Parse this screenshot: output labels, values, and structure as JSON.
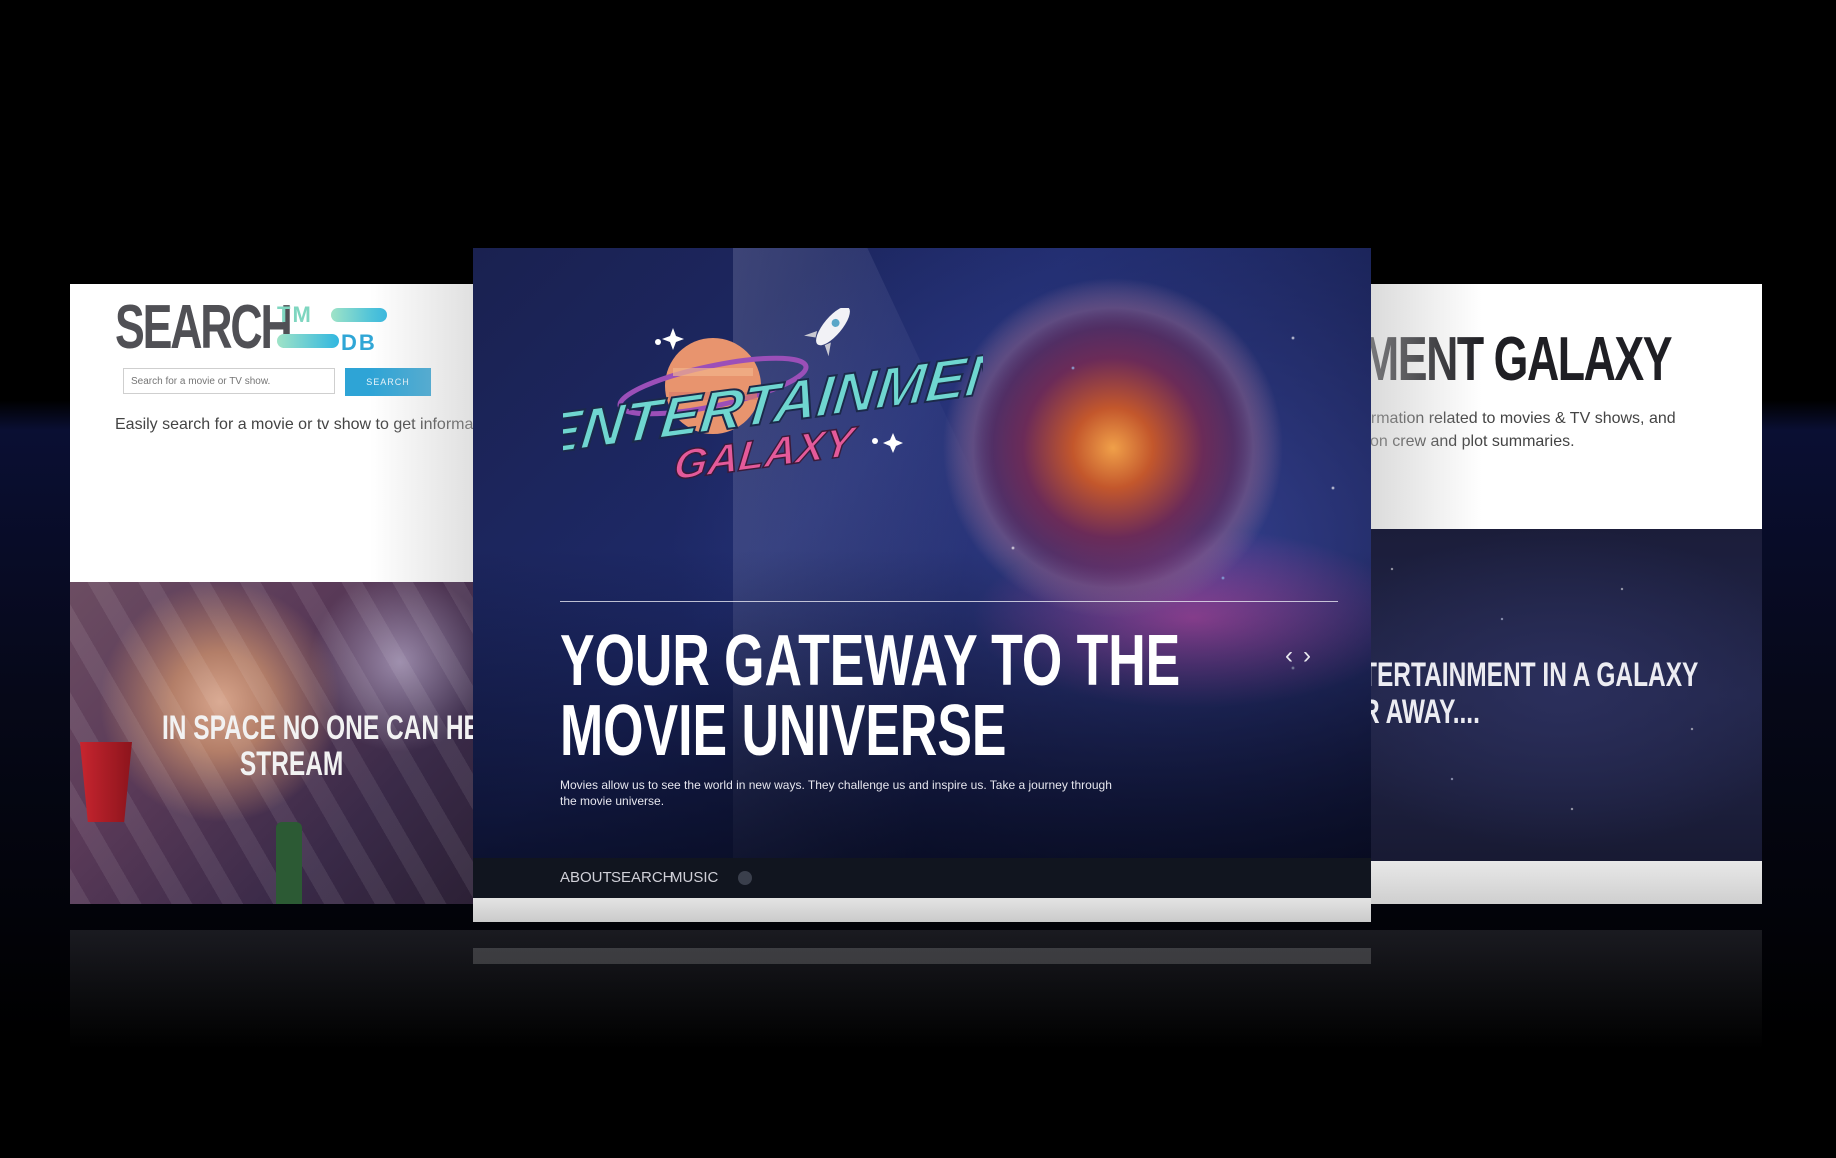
{
  "left_panel": {
    "logo_word": "SEARCH",
    "logo_tm": "TM",
    "logo_db": "DB",
    "search_placeholder": "Search for a movie or TV show.",
    "search_button": "SEARCH",
    "description": "Easily search for a movie or tv show to get informa",
    "hero_line1": "IN SPACE NO ONE CAN HEAR Y",
    "hero_line2": "STREAM"
  },
  "center_panel": {
    "logo_line1": "ENTERTAINMENT",
    "logo_line2": "GALAXY",
    "headline_line1": "YOUR GATEWAY TO THE",
    "headline_line2": "MOVIE UNIVERSE",
    "subtext": "Movies allow us to see the world in new ways. They challenge us and inspire us. Take a journey through the movie universe.",
    "prev_arrow": "‹",
    "next_arrow": "›",
    "nav": [
      "ABOUT",
      "SEARCH",
      "MUSIC"
    ]
  },
  "right_panel": {
    "title": "MENT GALAXY",
    "line1": "ormation related to movies & TV shows, and",
    "line2": "tion crew and plot summaries.",
    "space_line1": "TERTAINMENT IN A GALAXY",
    "space_line2": "R AWAY...."
  },
  "colors": {
    "background": "#000000",
    "accent_blue": "#2ea4d6",
    "nav_bar": "#11151f",
    "logo_cyan": "#6fd6d0",
    "logo_pink": "#e45a9a"
  },
  "icons": [
    "arrow-left-icon",
    "arrow-right-icon",
    "rocket-icon",
    "planet-icon",
    "sparkle-icon",
    "circle-icon"
  ]
}
